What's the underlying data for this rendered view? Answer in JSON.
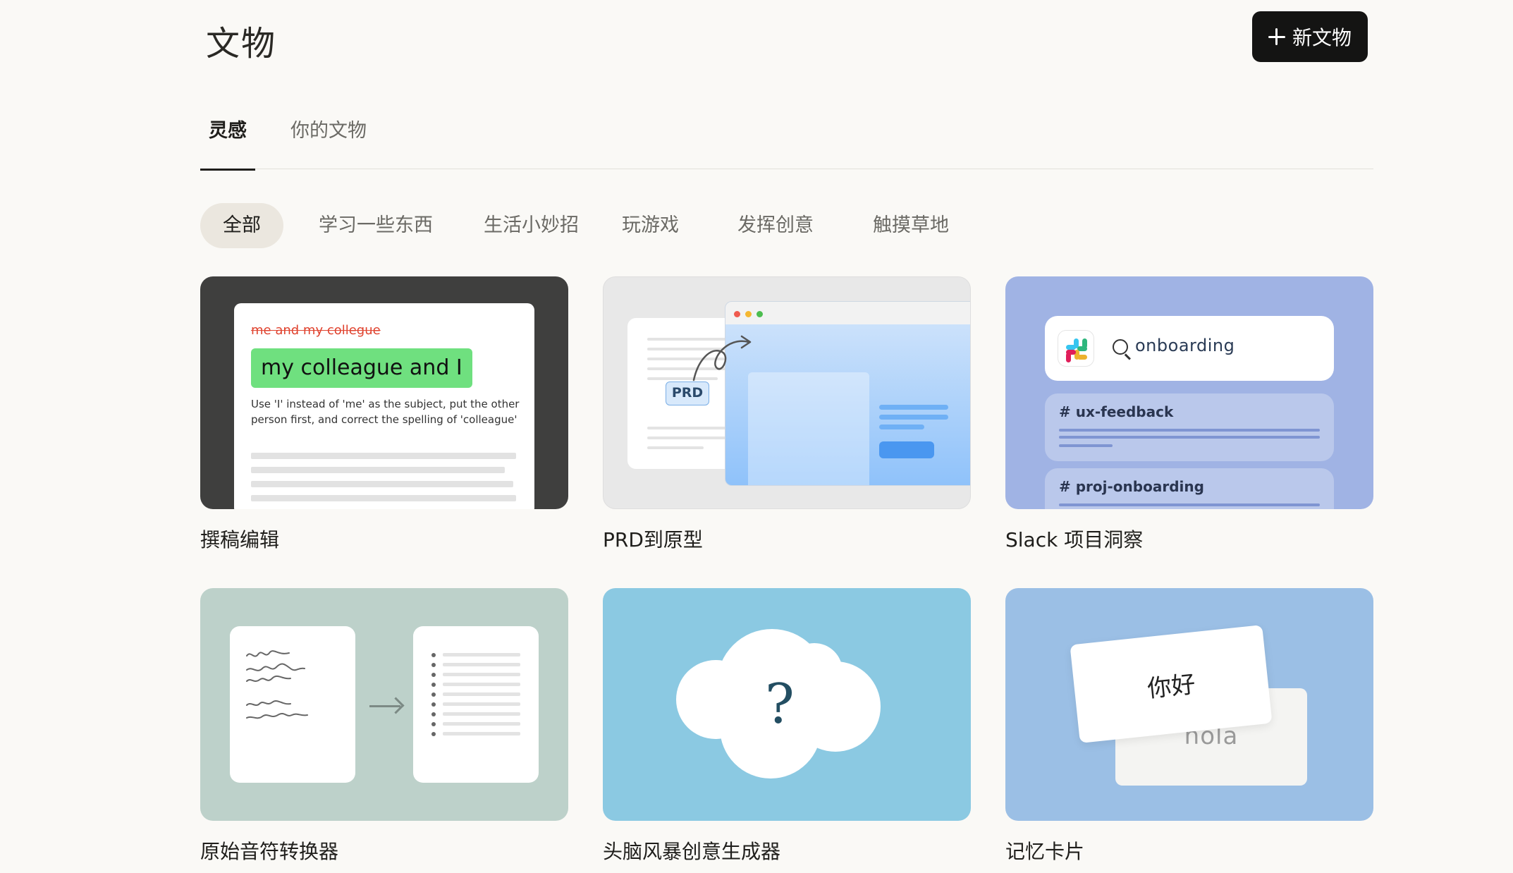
{
  "header": {
    "title": "文物",
    "new_button_label": "新文物"
  },
  "tabs": [
    {
      "label": "灵感",
      "active": true
    },
    {
      "label": "你的文物",
      "active": false
    }
  ],
  "filters": [
    {
      "label": "全部",
      "active": true
    },
    {
      "label": "学习一些东西",
      "active": false
    },
    {
      "label": "生活小妙招",
      "active": false
    },
    {
      "label": "玩游戏",
      "active": false
    },
    {
      "label": "发挥创意",
      "active": false
    },
    {
      "label": "触摸草地",
      "active": false
    }
  ],
  "cards": [
    {
      "label": "撰稿编辑",
      "preview": {
        "strikethrough": "me and my collegue",
        "highlight": "my colleague and I",
        "note": "Use 'I' instead of 'me' as the subject, put the other person first, and correct the spelling of 'colleague'"
      }
    },
    {
      "label": "PRD到原型",
      "preview": {
        "badge": "PRD"
      }
    },
    {
      "label": "Slack 项目洞察",
      "preview": {
        "search_text": "onboarding",
        "channels": [
          "# ux-feedback",
          "# proj-onboarding"
        ]
      }
    },
    {
      "label": "原始音符转换器"
    },
    {
      "label": "头脑风暴创意生成器",
      "preview": {
        "symbol": "?"
      }
    },
    {
      "label": "记忆卡片",
      "preview": {
        "front": "你好",
        "back": "hola"
      }
    }
  ],
  "colors": {
    "accent_dark": "#141413",
    "highlight_green": "#6fe07f",
    "strike_red": "#e0432f"
  }
}
